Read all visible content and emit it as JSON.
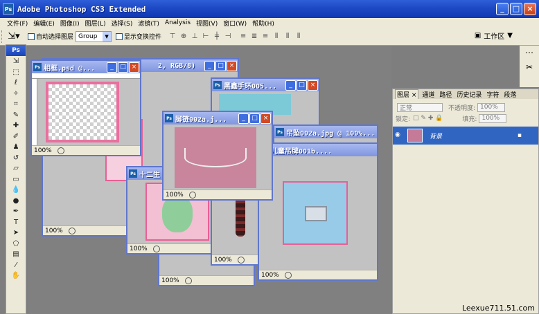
{
  "app": {
    "title": "Adobe Photoshop CS3 Extended",
    "icon_label": "Ps"
  },
  "menu": [
    "文件(F)",
    "编辑(E)",
    "图像(I)",
    "图层(L)",
    "选择(S)",
    "滤镜(T)",
    "Analysis",
    "视图(V)",
    "窗口(W)",
    "帮助(H)"
  ],
  "options": {
    "auto_select_label": "自动选择图层",
    "auto_select_value": "Group",
    "show_transform_label": "显示变换控件",
    "workspace_label": "工作区"
  },
  "toolbox": {
    "title": "Ps"
  },
  "documents": [
    {
      "id": "frame",
      "title": "相框.psd @...",
      "zoom": "100%"
    },
    {
      "id": "rgb",
      "title": "2, RGB/8)",
      "zoom": "100%"
    },
    {
      "id": "bracelet-black",
      "title": "黑鑫手环005...",
      "zoom": "100%"
    },
    {
      "id": "anklet",
      "title": "脚链002a.j...",
      "zoom": "100%"
    },
    {
      "id": "pendant",
      "title": "吊坠002a.jpg @ 100%...",
      "zoom": "100%"
    },
    {
      "id": "child-tag",
      "title": "儿童吊牌001b....",
      "zoom": "100%"
    },
    {
      "id": "zodiac",
      "title": "十二生",
      "zoom": "100%"
    },
    {
      "id": "back",
      "title": "",
      "zoom": "100%"
    }
  ],
  "layers_panel": {
    "tabs": [
      "图层 ×",
      "通道",
      "路径",
      "历史记录",
      "字符",
      "段落"
    ],
    "blend_mode": "正常",
    "opacity_label": "不透明度:",
    "opacity_value": "100%",
    "lock_label": "锁定:",
    "fill_label": "填充:",
    "fill_value": "100%",
    "layer_name": "背景"
  },
  "watermark": "Leexue711.51.com"
}
